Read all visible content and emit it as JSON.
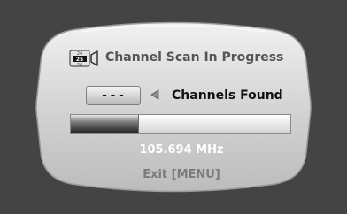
{
  "header": {
    "title": "Channel Scan In Progress",
    "icon": "tv-channel-scan-icon",
    "icon_digits": [
      "24",
      "25",
      "26"
    ]
  },
  "scan": {
    "channels_found_count": "---",
    "channels_found_label": "Channels Found",
    "progress_fraction": 0.31,
    "frequency": "105.694 MHz"
  },
  "footer": {
    "exit_hint": "Exit [MENU]"
  },
  "colors": {
    "background": "#444444",
    "panel": "#d5d5d5",
    "title_text": "#555555",
    "frequency_text": "#ffffff",
    "hint_text": "#7b7b7b"
  }
}
